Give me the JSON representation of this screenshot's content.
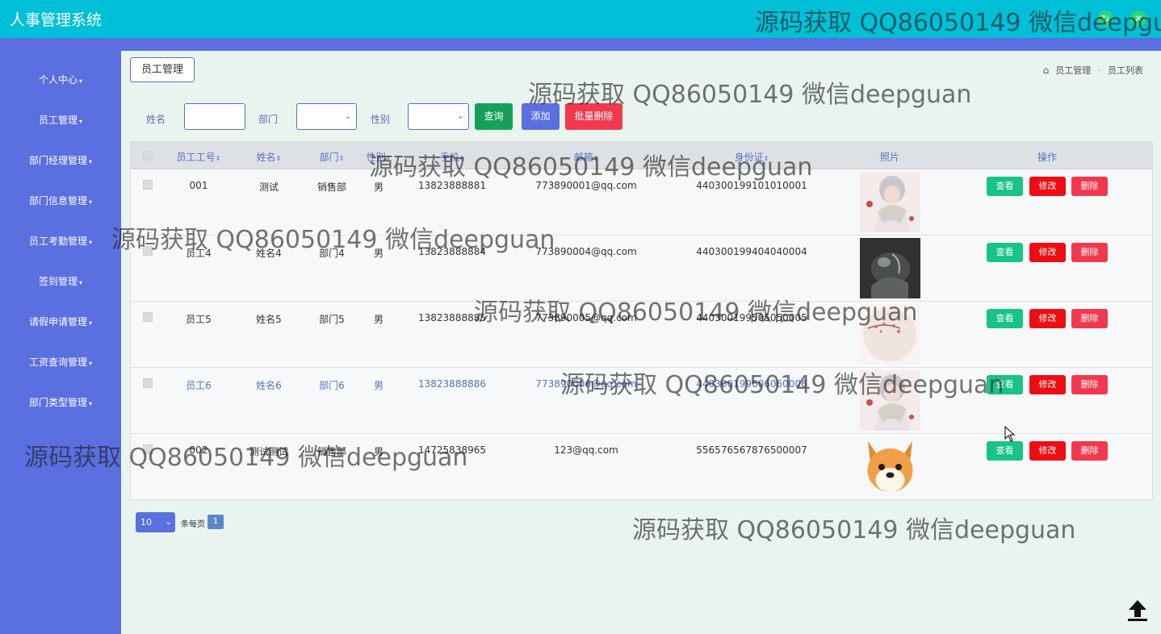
{
  "app": {
    "title": "人事管理系统"
  },
  "sidebar": {
    "items": [
      {
        "label": "个人中心"
      },
      {
        "label": "员工管理"
      },
      {
        "label": "部门经理管理"
      },
      {
        "label": "部门信息管理"
      },
      {
        "label": "员工考勤管理"
      },
      {
        "label": "签到管理"
      },
      {
        "label": "请假申请管理"
      },
      {
        "label": "工资查询管理"
      },
      {
        "label": "部门类型管理"
      }
    ]
  },
  "page": {
    "tag": "员工管理"
  },
  "breadcrumb": {
    "items": [
      "员工管理",
      "员工列表"
    ]
  },
  "search": {
    "name_label": "姓名",
    "name_value": "",
    "dept_label": "部门",
    "dept_value": "",
    "gender_label": "性别",
    "gender_value": "",
    "query_btn": "查询",
    "add_btn": "添加",
    "batch_delete_btn": "批量删除"
  },
  "table": {
    "headers": [
      "员工工号",
      "姓名",
      "部门",
      "性别",
      "手机",
      "邮箱",
      "身份证",
      "照片",
      "操作"
    ],
    "rows": [
      {
        "id": "001",
        "name": "测试",
        "dept": "销售部",
        "gender": "男",
        "phone": "13823888881",
        "email": "773890001@qq.com",
        "idcard": "440300199101010001"
      },
      {
        "id": "员工4",
        "name": "姓名4",
        "dept": "部门4",
        "gender": "男",
        "phone": "13823888884",
        "email": "773890004@qq.com",
        "idcard": "440300199404040004"
      },
      {
        "id": "员工5",
        "name": "姓名5",
        "dept": "部门5",
        "gender": "男",
        "phone": "13823888885",
        "email": "773890005@qq.com",
        "idcard": "440300199505050005"
      },
      {
        "id": "员工6",
        "name": "姓名6",
        "dept": "部门6",
        "gender": "男",
        "phone": "13823888886",
        "email": "773890006@qq.com",
        "idcard": "440300199606060006"
      },
      {
        "id": "002",
        "name": "测试测试",
        "dept": "销售部",
        "gender": "男",
        "phone": "14725838965",
        "email": "123@qq.com",
        "idcard": "556576567876500007"
      }
    ],
    "actions": {
      "view": "查看",
      "edit": "修改",
      "delete": "删除"
    }
  },
  "pagination": {
    "page_size": "10",
    "per_page_label": "条每页",
    "current_page": "1"
  },
  "watermark": "源码获取 QQ86050149 微信deepguan",
  "colors": {
    "topbar": "#00c0d8",
    "sidebar": "#5a6fe0",
    "view": "#17c389",
    "edit": "#ee0d12",
    "delete": "#f2384e"
  }
}
